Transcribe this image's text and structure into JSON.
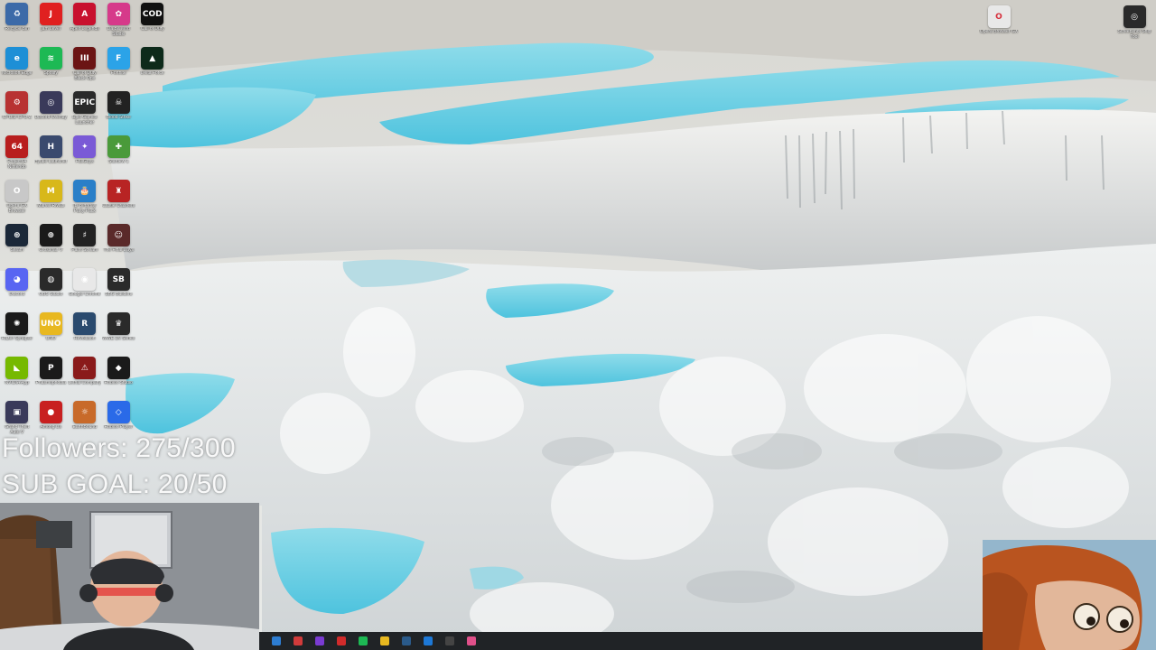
{
  "desktop_icons": [
    {
      "name": "recycle-bin-icon",
      "label": "Recycle Bin",
      "color": "#3c6aa8",
      "glyph": "♻"
    },
    {
      "name": "jam-icon",
      "label": "jam Level",
      "color": "#e02020",
      "glyph": "J"
    },
    {
      "name": "apex-legends-icon",
      "label": "Apex Legends",
      "color": "#c8102e",
      "glyph": "A"
    },
    {
      "name": "cheat-engine-icon",
      "label": "Da Ba Mod Studio",
      "color": "#d63a8a",
      "glyph": "✿"
    },
    {
      "name": "call-of-duty-icon",
      "label": "Call of Duty",
      "color": "#111111",
      "glyph": "COD"
    },
    {
      "name": "microsoft-edge-icon",
      "label": "Microsoft Edge",
      "color": "#1d8fd6",
      "glyph": "e"
    },
    {
      "name": "spotify-icon",
      "label": "Spotify",
      "color": "#1db954",
      "glyph": "≋"
    },
    {
      "name": "call-of-duty-bo-icon",
      "label": "Call of Duty Black Ops",
      "color": "#6b1414",
      "glyph": "III"
    },
    {
      "name": "fortnite-icon",
      "label": "Fortnite",
      "color": "#2ba3e8",
      "glyph": "F"
    },
    {
      "name": "delta-force-icon",
      "label": "Delta Force",
      "color": "#0d2a1a",
      "glyph": "▲"
    },
    {
      "name": "cpuid-icon",
      "label": "CPUID CPU-Z",
      "color": "#b83232",
      "glyph": "⚙"
    },
    {
      "name": "obs-icon",
      "label": "Discord Overlay",
      "color": "#3a3a5a",
      "glyph": "◎"
    },
    {
      "name": "epic-games-icon",
      "label": "Epic Games Launcher",
      "color": "#2a2a2a",
      "glyph": "EPIC"
    },
    {
      "name": "blood-strike-icon",
      "label": "Blood Strike",
      "color": "#222222",
      "glyph": "☠"
    },
    {
      "name": "blank-1-icon",
      "label": "",
      "color": "transparent",
      "glyph": ""
    },
    {
      "name": "n64-icon",
      "label": "Project64 Nintendo",
      "color": "#b81e1e",
      "glyph": "64"
    },
    {
      "name": "hytale-icon",
      "label": "Hytale Launcher",
      "color": "#3a4a6e",
      "glyph": "H"
    },
    {
      "name": "fl-studio-icon",
      "label": "FallGuys",
      "color": "#7a5ad6",
      "glyph": "✦"
    },
    {
      "name": "minecraft-icon",
      "label": "Stardew 1",
      "color": "#4a9a3a",
      "glyph": "✚"
    },
    {
      "name": "blank-2-icon",
      "label": "",
      "color": "transparent",
      "glyph": ""
    },
    {
      "name": "opera-gx-icon",
      "label": "Opera GX Browser",
      "color": "#c8c8c8",
      "glyph": "O"
    },
    {
      "name": "marvel-rivals-icon",
      "label": "Marvel Rivals",
      "color": "#d8b81a",
      "glyph": "M"
    },
    {
      "name": "birthday-icon",
      "label": "Its Birthday Party Pack",
      "color": "#2a7fc8",
      "glyph": "🎂"
    },
    {
      "name": "roblox-studio-icon",
      "label": "Castle Crashers",
      "color": "#b82424",
      "glyph": "♜"
    },
    {
      "name": "blank-3-icon",
      "label": "",
      "color": "transparent",
      "glyph": ""
    },
    {
      "name": "steam-icon",
      "label": "Steam",
      "color": "#1b2838",
      "glyph": "⊛"
    },
    {
      "name": "crosshair-icon",
      "label": "Crosshair V",
      "color": "#1a1a1a",
      "glyph": "⊕"
    },
    {
      "name": "fl-studio-2-icon",
      "label": "Paint Stream",
      "color": "#222222",
      "glyph": "♯"
    },
    {
      "name": "red-dead-icon",
      "label": "The Final Days",
      "color": "#5a2a2a",
      "glyph": "☺"
    },
    {
      "name": "blank-4-icon",
      "label": "",
      "color": "transparent",
      "glyph": ""
    },
    {
      "name": "discord-icon",
      "label": "Discord",
      "color": "#5865f2",
      "glyph": "◕"
    },
    {
      "name": "obs-studio-icon",
      "label": "OBS Studio",
      "color": "#2a2a2a",
      "glyph": "◍"
    },
    {
      "name": "google-chrome-icon",
      "label": "Google Chrome",
      "color": "#e8e8e8",
      "glyph": "◉"
    },
    {
      "name": "subnautica-icon",
      "label": "SBG Builders",
      "color": "#2a2a2a",
      "glyph": "SB"
    },
    {
      "name": "blank-5-icon",
      "label": "",
      "color": "transparent",
      "glyph": ""
    },
    {
      "name": "razer-icon",
      "label": "Razer Synapse",
      "color": "#1a1a1a",
      "glyph": "✺"
    },
    {
      "name": "uno-icon",
      "label": "UNO",
      "color": "#e8b820",
      "glyph": "UNO"
    },
    {
      "name": "rstudio-icon",
      "label": "Revolution",
      "color": "#2a4a6e",
      "glyph": "R"
    },
    {
      "name": "wwe-icon",
      "label": "WWE 2K Series",
      "color": "#2a2a2a",
      "glyph": "♛"
    },
    {
      "name": "blank-6-icon",
      "label": "",
      "color": "transparent",
      "glyph": ""
    },
    {
      "name": "nvidia-icon",
      "label": "NVIDIA App",
      "color": "#76b900",
      "glyph": "◣"
    },
    {
      "name": "phasmophobia-icon",
      "label": "Phasmophobia",
      "color": "#1a1a1a",
      "glyph": "P"
    },
    {
      "name": "lethal-company-icon",
      "label": "Lethal Company",
      "color": "#8a1a1a",
      "glyph": "⚠"
    },
    {
      "name": "roblox-icon",
      "label": "Roblox Studio",
      "color": "#1a1a1a",
      "glyph": "◆"
    },
    {
      "name": "blank-7-icon",
      "label": "",
      "color": "transparent",
      "glyph": ""
    },
    {
      "name": "grand-theft-icon",
      "label": "Grand Theft Auto V",
      "color": "#3a3a5a",
      "glyph": "▣"
    },
    {
      "name": "among-us-icon",
      "label": "Among Us",
      "color": "#c82020",
      "glyph": "●"
    },
    {
      "name": "earthbound-icon",
      "label": "EarthBound",
      "color": "#c86a2a",
      "glyph": "☼"
    },
    {
      "name": "roblox-player-icon",
      "label": "Roblox Player",
      "color": "#2a6ae8",
      "glyph": "◇"
    },
    {
      "name": "blank-8-icon",
      "label": "",
      "color": "transparent",
      "glyph": ""
    }
  ],
  "right_icons": [
    {
      "name": "opera-gx-right-icon",
      "label": "Opera Browser GX",
      "color": "#e8e8e8",
      "glyph": "O"
    },
    {
      "name": "screenshot-icon",
      "label": "Screenshot Snip Tool",
      "color": "#2a2a2a",
      "glyph": "◎"
    }
  ],
  "overlay": {
    "followers": "Followers: 275/300",
    "subs": "SUB GOAL: 20/50"
  },
  "taskbar_items": [
    {
      "name": "taskbar-start-icon",
      "color": "#2d7dd2"
    },
    {
      "name": "taskbar-opera-icon",
      "color": "#d13b3b"
    },
    {
      "name": "taskbar-gx-icon",
      "color": "#7a3bd1"
    },
    {
      "name": "taskbar-obs-icon",
      "color": "#d12b2b"
    },
    {
      "name": "taskbar-spotify-icon",
      "color": "#1db954"
    },
    {
      "name": "taskbar-chrome-icon",
      "color": "#e8b820"
    },
    {
      "name": "taskbar-steam-icon",
      "color": "#2a5a8a"
    },
    {
      "name": "taskbar-mail-icon",
      "color": "#1d78d6"
    },
    {
      "name": "taskbar-epic-icon",
      "color": "#444444"
    },
    {
      "name": "taskbar-discord-icon",
      "color": "#e0508a"
    }
  ]
}
